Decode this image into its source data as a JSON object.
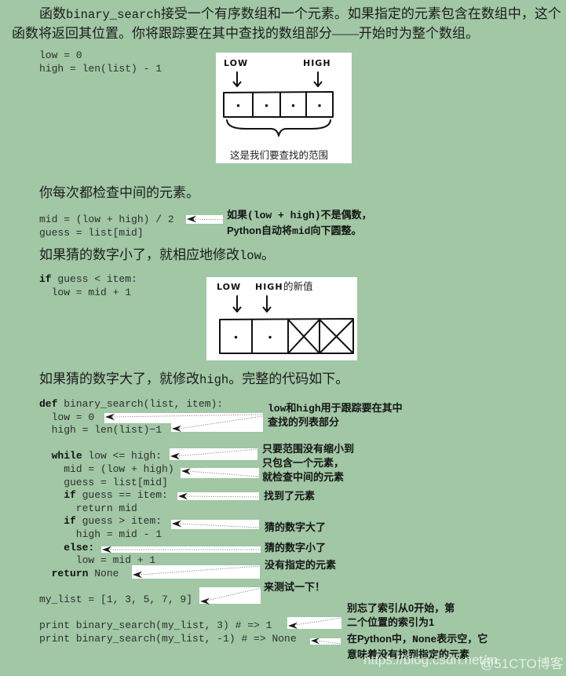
{
  "page": {
    "background": "#a1c7a5"
  },
  "intro": {
    "lines": [
      [
        [
          "t",
          "函数"
        ],
        [
          "c",
          "binary_search"
        ],
        [
          "t",
          "接受一个有序数组和一个元素。如果指定的元素包含在数组中，这个"
        ]
      ],
      [
        [
          "t",
          "函数将返回其位置。你将跟踪要在其中查找的数组部分——开始时为整个数组。"
        ]
      ]
    ]
  },
  "check_middle": {
    "lines": [
      [
        [
          "t",
          "你每次都检查中间的元素。"
        ]
      ]
    ]
  },
  "guess_low": {
    "lines": [
      [
        [
          "t",
          "如果猜的数字小了，就相应地修改"
        ],
        [
          "c",
          "low"
        ],
        [
          "t",
          "。"
        ]
      ]
    ]
  },
  "guess_high": {
    "lines": [
      [
        [
          "t",
          "如果猜的数字大了，就修改"
        ],
        [
          "c",
          "high"
        ],
        [
          "t",
          "。完整的代码如下。"
        ]
      ]
    ]
  },
  "code_blocks": {
    "init": [
      [
        [
          "t",
          "low = 0"
        ]
      ],
      [
        [
          "t",
          "high = len(list) - 1"
        ]
      ]
    ],
    "mid": [
      [
        [
          "t",
          "mid = (low + high) / 2"
        ]
      ],
      [
        [
          "t",
          "guess = list[mid]"
        ]
      ]
    ],
    "low_update": [
      [
        [
          "k",
          "if"
        ],
        [
          "t",
          " guess < item:"
        ]
      ],
      [
        [
          "t",
          "  low = mid + 1"
        ]
      ]
    ],
    "full": [
      [
        [
          "k",
          "def"
        ],
        [
          "t",
          " binary_search(list, item):"
        ]
      ],
      [
        [
          "t",
          "  low = 0"
        ]
      ],
      [
        [
          "t",
          "  high = len(list)−1"
        ]
      ],
      [],
      [
        [
          "t",
          "  "
        ],
        [
          "k",
          "while"
        ],
        [
          "t",
          " low <= high:"
        ]
      ],
      [
        [
          "t",
          "    mid = (low + high)"
        ]
      ],
      [
        [
          "t",
          "    guess = list[mid]"
        ]
      ],
      [
        [
          "t",
          "    "
        ],
        [
          "k",
          "if"
        ],
        [
          "t",
          " guess == item:"
        ]
      ],
      [
        [
          "t",
          "      return mid"
        ]
      ],
      [
        [
          "t",
          "    "
        ],
        [
          "k",
          "if"
        ],
        [
          "t",
          " guess > item:"
        ]
      ],
      [
        [
          "t",
          "      high = mid - 1"
        ]
      ],
      [
        [
          "t",
          "    "
        ],
        [
          "k",
          "else:"
        ]
      ],
      [
        [
          "t",
          "      low = mid + 1"
        ]
      ],
      [
        [
          "t",
          "  "
        ],
        [
          "k",
          "return"
        ],
        [
          "t",
          " None"
        ]
      ],
      [],
      [
        [
          "t",
          "my_list = [1, 3, 5, 7, 9]"
        ]
      ],
      [],
      [
        [
          "t",
          "print binary_search(my_list, 3) # => 1"
        ]
      ],
      [
        [
          "t",
          "print binary_search(my_list, -1) # => None"
        ]
      ]
    ]
  },
  "annotations": {
    "mid_rounding": [
      [
        [
          "t",
          "如果"
        ],
        [
          "c",
          "(low + high)"
        ],
        [
          "t",
          "不是偶数，"
        ]
      ],
      [
        [
          "t",
          "Python自动将"
        ],
        [
          "c",
          "mid"
        ],
        [
          "t",
          "向下圆整。"
        ]
      ]
    ],
    "range_tracking": [
      [
        [
          "c",
          "low"
        ],
        [
          "t",
          "和"
        ],
        [
          "c",
          "high"
        ],
        [
          "t",
          "用于跟踪要在其中"
        ]
      ],
      [
        [
          "t",
          "查找的列表部分"
        ]
      ]
    ],
    "loop_condition": [
      [
        [
          "t",
          "只要范围没有缩小到"
        ]
      ],
      [
        [
          "t",
          "只包含一个元素，"
        ]
      ],
      [
        [
          "t",
          "就检查中间的元素"
        ]
      ]
    ],
    "found": [
      [
        [
          "t",
          "找到了元素"
        ]
      ]
    ],
    "too_high": [
      [
        [
          "t",
          "猜的数字大了"
        ]
      ]
    ],
    "too_low": [
      [
        [
          "t",
          "猜的数字小了"
        ]
      ]
    ],
    "not_found": [
      [
        [
          "t",
          "没有指定的元素"
        ]
      ]
    ],
    "try_it": [
      [
        [
          "t",
          "来测试一下！"
        ]
      ]
    ],
    "index_note": [
      [
        [
          "t",
          "别忘了索引从0开始，第"
        ]
      ],
      [
        [
          "t",
          "二个位置的索引为1"
        ]
      ]
    ],
    "none_note": [
      [
        [
          "t",
          "在Python中，"
        ],
        [
          "c",
          "None"
        ],
        [
          "t",
          "表示空，它"
        ]
      ],
      [
        [
          "t",
          "意味着没有找到指定的元素"
        ]
      ]
    ]
  },
  "figure_initial": {
    "low_label": "LOW",
    "high_label": "HIGH",
    "caption": "这是我们要查找的范围",
    "cell_states": [
      "dot",
      "dot",
      "dot",
      "dot"
    ]
  },
  "figure_after": {
    "low_label": "LOW",
    "high_label": "HIGH",
    "high_suffix": "的新值",
    "cell_states": [
      "dot",
      "dot",
      "x",
      "x"
    ]
  },
  "watermark": {
    "url": "https://blog.csdn.net/m",
    "brand": "@51CTO博客"
  }
}
